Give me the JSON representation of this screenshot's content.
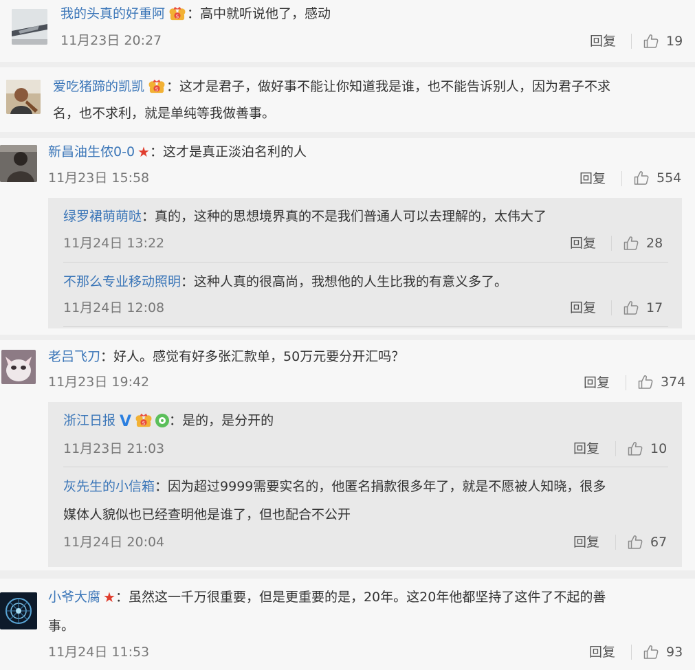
{
  "reply_label": "回复",
  "colon": "：",
  "colors": {
    "name": "#3b76b8",
    "background": "#eeeeee",
    "card": "#f7f7f7",
    "subbox": "#e9e9e9",
    "star": "#e03c2d",
    "verified": "#2b7fe0"
  },
  "comments": [
    {
      "name": "我的头真的好重阿",
      "badges": [
        "vip-crown-icon"
      ],
      "text_lines": [
        "高中就听说他了，感动"
      ],
      "date": "11月23日 20:27",
      "likes": "19"
    },
    {
      "name": "爱吃猪蹄的凯凯",
      "badges": [
        "vip-crown-icon"
      ],
      "text_lines": [
        "这才是君子，做好事不能让你知道我是谁，也不能告诉别人，因为君子不求",
        "名，也不求利，就是单纯等我做善事。"
      ]
    },
    {
      "name": "新昌油生侬0-0",
      "badges": [
        "star-icon"
      ],
      "text_lines": [
        "这才是真正淡泊名利的人"
      ],
      "date": "11月23日 15:58",
      "likes": "554",
      "replies": [
        {
          "name": "绿罗裙萌萌哒",
          "text_lines": [
            "真的，这种的思想境界真的不是我们普通人可以去理解的，太伟大了"
          ],
          "date": "11月24日 13:22",
          "likes": "28"
        },
        {
          "name": "不那么专业移动照明",
          "text_lines": [
            "这种人真的很高尚，我想他的人生比我的有意义多了。"
          ],
          "date": "11月24日 12:08",
          "likes": "17"
        }
      ]
    },
    {
      "name": "老吕飞刀",
      "badges": [],
      "text_lines": [
        "好人。感觉有好多张汇款单，50万元要分开汇吗？"
      ],
      "date": "11月23日 19:42",
      "likes": "374",
      "replies": [
        {
          "name": "浙江日报",
          "badges": [
            "verified-v-icon",
            "vip-crown-icon",
            "green-circle-icon"
          ],
          "text_lines": [
            "是的，是分开的"
          ],
          "date": "11月23日 21:03",
          "likes": "10"
        },
        {
          "name": "灰先生的小信箱",
          "text_lines": [
            "因为超过9999需要实名的，他匿名捐款很多年了，就是不愿被人知晓，很多",
            "媒体人貌似也已经查明他是谁了，但也配合不公开"
          ],
          "date": "11月24日 20:04",
          "likes": "67"
        }
      ]
    },
    {
      "name": "小爷大腐",
      "badges": [
        "star-icon"
      ],
      "text_lines": [
        "虽然这一千万很重要，但是更重要的是，20年。这20年他都坚持了这件了不起的善",
        "事。"
      ],
      "date": "11月24日 11:53",
      "likes": "93"
    }
  ]
}
